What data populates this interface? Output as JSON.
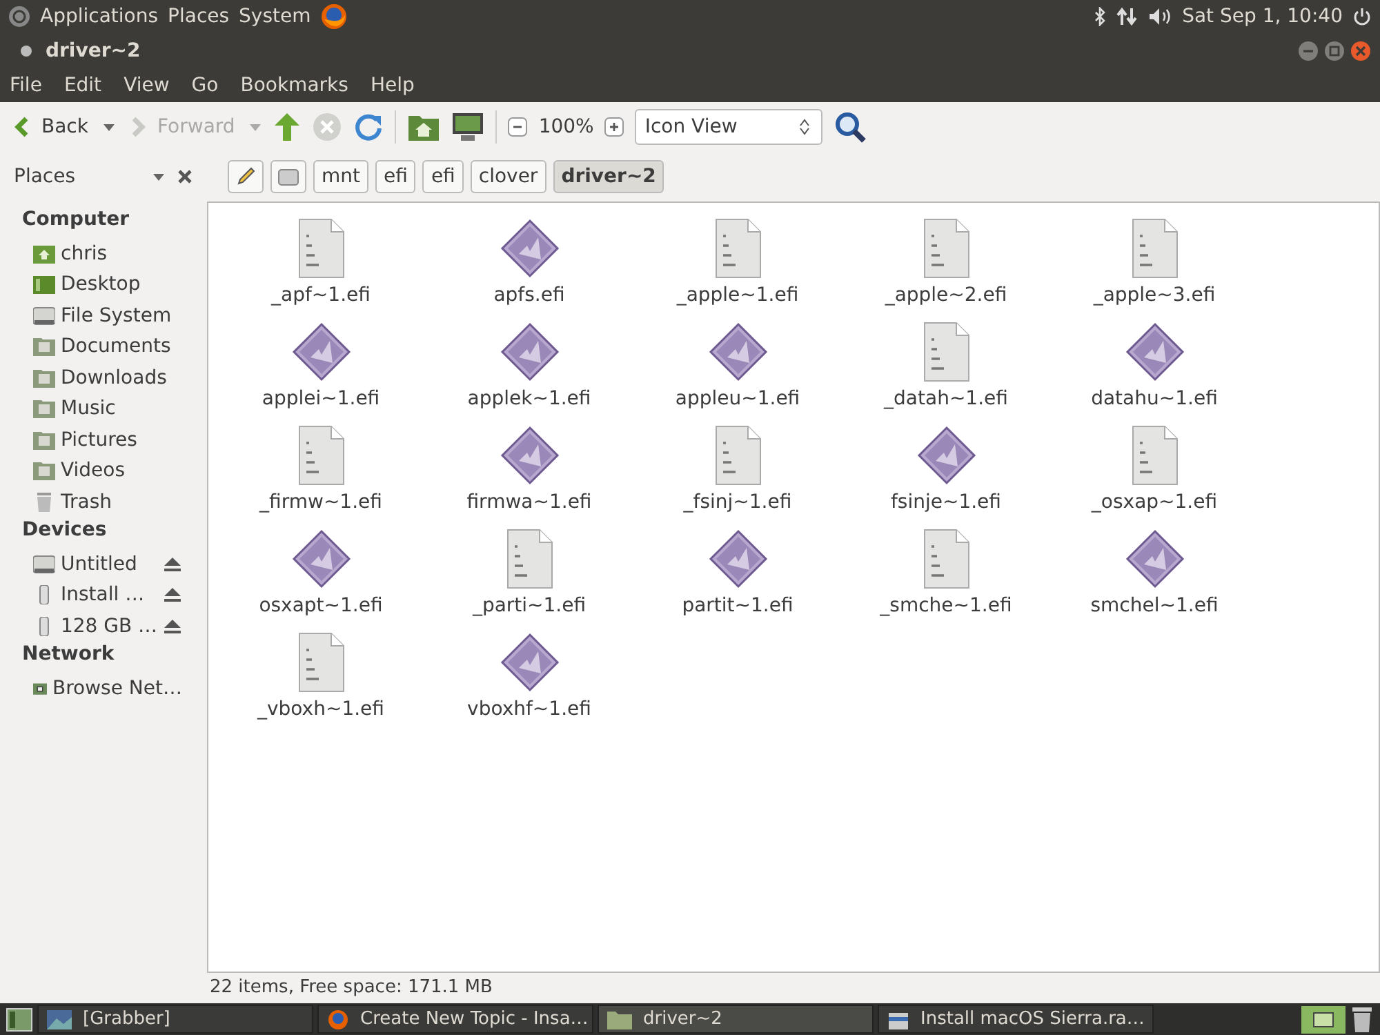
{
  "top_panel": {
    "menus": [
      "Applications",
      "Places",
      "System"
    ],
    "clock": "Sat Sep 1, 10:40"
  },
  "window": {
    "title": "driver~2"
  },
  "menu_bar": [
    "File",
    "Edit",
    "View",
    "Go",
    "Bookmarks",
    "Help"
  ],
  "toolbar": {
    "back": "Back",
    "forward": "Forward",
    "forward_disabled": true,
    "zoom": "100%",
    "view_mode": "Icon View"
  },
  "sidebar": {
    "title": "Places"
  },
  "path_bar": [
    {
      "label": "mnt",
      "selected": false
    },
    {
      "label": "efi",
      "selected": false
    },
    {
      "label": "efi",
      "selected": false
    },
    {
      "label": "clover",
      "selected": false
    },
    {
      "label": "driver~2",
      "selected": true
    }
  ],
  "places": [
    {
      "heading": "Computer",
      "items": [
        {
          "label": "chris",
          "kind": "home",
          "eject": false
        },
        {
          "label": "Desktop",
          "kind": "desktop",
          "eject": false
        },
        {
          "label": "File System",
          "kind": "drive",
          "eject": false
        },
        {
          "label": "Documents",
          "kind": "folder",
          "eject": false
        },
        {
          "label": "Downloads",
          "kind": "folder",
          "eject": false
        },
        {
          "label": "Music",
          "kind": "folder",
          "eject": false
        },
        {
          "label": "Pictures",
          "kind": "folder",
          "eject": false
        },
        {
          "label": "Videos",
          "kind": "folder",
          "eject": false
        },
        {
          "label": "Trash",
          "kind": "trash",
          "eject": false
        }
      ]
    },
    {
      "heading": "Devices",
      "items": [
        {
          "label": "Untitled",
          "kind": "drive",
          "eject": true
        },
        {
          "label": "Install …",
          "kind": "usb",
          "eject": true
        },
        {
          "label": "128 GB …",
          "kind": "usb",
          "eject": true
        }
      ]
    },
    {
      "heading": "Network",
      "items": [
        {
          "label": "Browse Net…",
          "kind": "network",
          "eject": false
        }
      ]
    }
  ],
  "files": [
    {
      "name": "_apf~1.efi",
      "kind": "binary"
    },
    {
      "name": "apfs.efi",
      "kind": "executable"
    },
    {
      "name": "_apple~1.efi",
      "kind": "binary"
    },
    {
      "name": "_apple~2.efi",
      "kind": "binary"
    },
    {
      "name": "_apple~3.efi",
      "kind": "binary"
    },
    {
      "name": "applei~1.efi",
      "kind": "executable"
    },
    {
      "name": "applek~1.efi",
      "kind": "executable"
    },
    {
      "name": "appleu~1.efi",
      "kind": "executable"
    },
    {
      "name": "_datah~1.efi",
      "kind": "binary"
    },
    {
      "name": "datahu~1.efi",
      "kind": "executable"
    },
    {
      "name": "_firmw~1.efi",
      "kind": "binary"
    },
    {
      "name": "firmwa~1.efi",
      "kind": "executable"
    },
    {
      "name": "_fsinj~1.efi",
      "kind": "binary"
    },
    {
      "name": "fsinje~1.efi",
      "kind": "executable"
    },
    {
      "name": "_osxap~1.efi",
      "kind": "binary"
    },
    {
      "name": "osxapt~1.efi",
      "kind": "executable"
    },
    {
      "name": "_parti~1.efi",
      "kind": "binary"
    },
    {
      "name": "partit~1.efi",
      "kind": "executable"
    },
    {
      "name": "_smche~1.efi",
      "kind": "binary"
    },
    {
      "name": "smchel~1.efi",
      "kind": "executable"
    },
    {
      "name": "_vboxh~1.efi",
      "kind": "binary"
    },
    {
      "name": "vboxhf~1.efi",
      "kind": "executable"
    }
  ],
  "status_bar": "22 items, Free space: 171.1 MB",
  "taskbar": [
    {
      "label": "[Grabber]",
      "kind": "image",
      "selected": false
    },
    {
      "label": "Create New Topic - Insa…",
      "kind": "browser",
      "selected": false
    },
    {
      "label": "driver~2",
      "kind": "folder",
      "selected": true
    },
    {
      "label": "Install macOS Sierra.ra…",
      "kind": "archive",
      "selected": false
    }
  ]
}
